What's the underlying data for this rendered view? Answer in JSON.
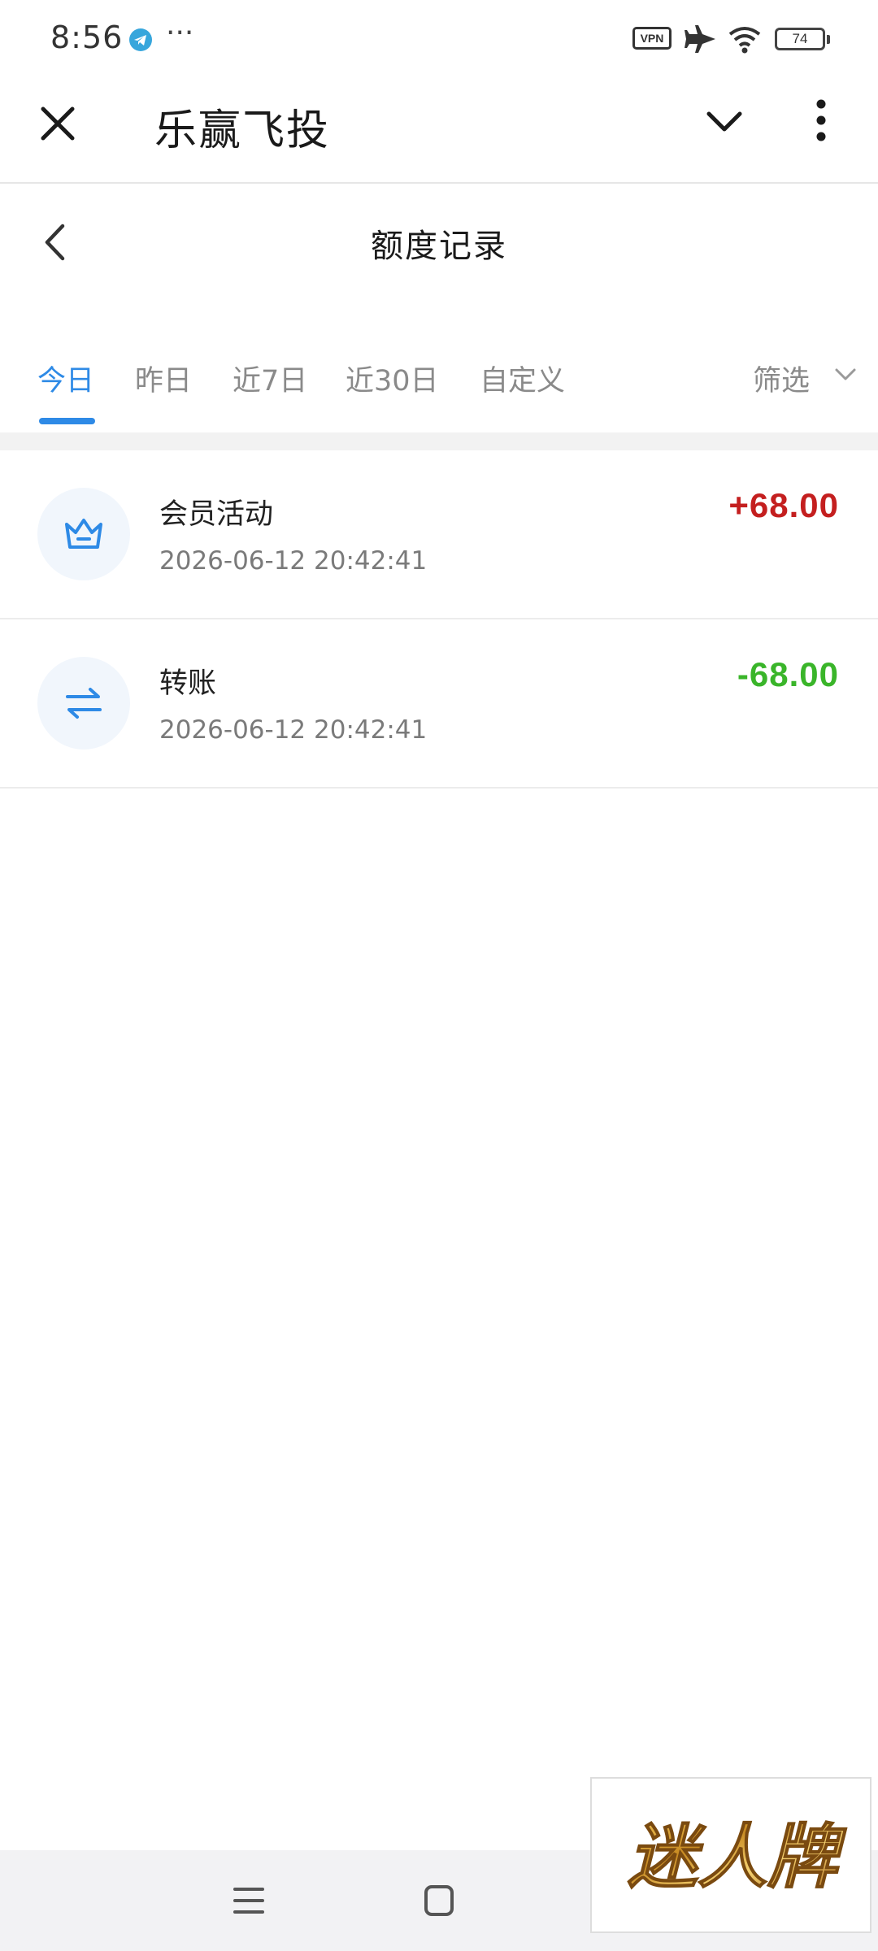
{
  "status_bar": {
    "time": "8:56",
    "dots": "···",
    "vpn_label": "VPN",
    "battery_level": "74",
    "icons": [
      "telegram-icon",
      "vpn-icon",
      "airplane-icon",
      "wifi-icon",
      "battery-icon"
    ]
  },
  "app_header": {
    "title": "乐赢飞投",
    "icons": [
      "close-icon",
      "chevron-down-icon",
      "more-vertical-icon"
    ]
  },
  "page": {
    "title": "额度记录",
    "back_icon": "chevron-left-icon"
  },
  "tabs": {
    "items": [
      {
        "label": "今日",
        "active": true
      },
      {
        "label": "昨日",
        "active": false
      },
      {
        "label": "近7日",
        "active": false
      },
      {
        "label": "近30日",
        "active": false
      },
      {
        "label": "自定义",
        "active": false
      }
    ],
    "filter_label": "筛选",
    "accent_color": "#2e8ae6"
  },
  "records": [
    {
      "icon": "crown-icon",
      "title": "会员活动",
      "time": "2026-06-12 20:42:41",
      "amount": "+68.00",
      "amount_color": "#c41f1f"
    },
    {
      "icon": "transfer-arrows-icon",
      "title": "转账",
      "time": "2026-06-12 20:42:41",
      "amount": "-68.00",
      "amount_color": "#3ab52a"
    }
  ],
  "nav_bar": {
    "icons": [
      "menu-icon",
      "home-square-icon"
    ]
  },
  "logo": {
    "text": "迷人牌"
  }
}
